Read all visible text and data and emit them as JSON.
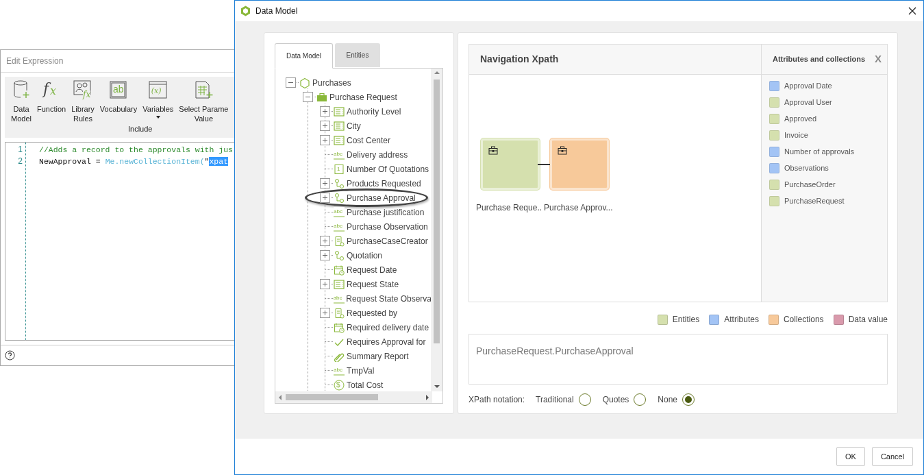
{
  "edit_window": {
    "title": "Edit Expression",
    "toolbar": [
      {
        "kind": "datamodel",
        "lines": [
          "Data",
          "Model"
        ],
        "dropdown": false
      },
      {
        "kind": "function",
        "glyphs": [
          "f",
          "x"
        ],
        "lines": [
          "Function"
        ],
        "dropdown": false
      },
      {
        "kind": "library",
        "glyphs": [
          "fx"
        ],
        "lines": [
          "Library",
          "Rules"
        ],
        "dropdown": false
      },
      {
        "kind": "vocabulary",
        "glyphs": [
          "ab"
        ],
        "lines": [
          "Vocabulary"
        ],
        "dropdown": false
      },
      {
        "kind": "variables",
        "glyphs": [
          "(x)"
        ],
        "lines": [
          "Variables"
        ],
        "dropdown": true
      },
      {
        "kind": "parameter",
        "lines": [
          "Select Parame",
          "Value"
        ],
        "dropdown": false
      }
    ],
    "group_label": "Include",
    "code_lines": [
      {
        "number": "1",
        "tokens": [
          {
            "kind": "comment",
            "text": "//Adds a record to the approvals with jus"
          }
        ]
      },
      {
        "number": "2",
        "tokens": [
          {
            "kind": "plain",
            "text": "NewApproval = "
          },
          {
            "kind": "member",
            "text": "Me.newCollectionItem("
          },
          {
            "kind": "plain",
            "text": "\""
          },
          {
            "kind": "selected",
            "text": "xpat"
          }
        ]
      }
    ]
  },
  "dialog": {
    "title": "Data Model",
    "tabs": [
      {
        "label": "Data Model",
        "selected": true
      },
      {
        "label": "Entities",
        "selected": false
      }
    ],
    "tree": [
      {
        "label": "Purchases",
        "kind": "hexagon",
        "expanded": true,
        "circled": false,
        "children": [
          {
            "label": "Purchase Request",
            "kind": "briefcase",
            "expanded": true,
            "circled": false,
            "children": [
              {
                "label": "Authority Level",
                "kind": "list",
                "expanded": false,
                "circled": false
              },
              {
                "label": "City",
                "kind": "list",
                "expanded": false,
                "circled": false
              },
              {
                "label": "Cost Center",
                "kind": "list",
                "expanded": false,
                "circled": false
              },
              {
                "label": "Delivery address",
                "kind": "text",
                "glyph": "abc",
                "circled": false
              },
              {
                "label": "Number Of Quotations",
                "kind": "number",
                "glyph": "1",
                "circled": false
              },
              {
                "label": "Products Requested",
                "kind": "relation",
                "expanded": false,
                "circled": false
              },
              {
                "label": "Purchase Approval",
                "kind": "relation",
                "expanded": false,
                "circled": true
              },
              {
                "label": "Purchase justification",
                "kind": "text",
                "glyph": "abc",
                "circled": false
              },
              {
                "label": "Purchase Observation",
                "kind": "text",
                "glyph": "abc",
                "circled": false
              },
              {
                "label": "PurchaseCaseCreator",
                "kind": "user",
                "expanded": false,
                "circled": false
              },
              {
                "label": "Quotation",
                "kind": "relation",
                "expanded": false,
                "circled": false
              },
              {
                "label": "Request Date",
                "kind": "date",
                "circled": false
              },
              {
                "label": "Request State",
                "kind": "list",
                "expanded": false,
                "circled": false
              },
              {
                "label": "Request State Observa",
                "kind": "text",
                "glyph": "abc",
                "circled": false
              },
              {
                "label": "Requested by",
                "kind": "user",
                "expanded": false,
                "circled": false
              },
              {
                "label": "Required delivery date",
                "kind": "date",
                "circled": false
              },
              {
                "label": "Requires Approval for",
                "kind": "check",
                "circled": false
              },
              {
                "label": "Summary Report",
                "kind": "clip",
                "circled": false
              },
              {
                "label": "TmpVal",
                "kind": "text",
                "glyph": "abc",
                "circled": false
              },
              {
                "label": "Total Cost",
                "kind": "money",
                "glyph": "$",
                "circled": false
              }
            ]
          }
        ]
      }
    ],
    "navigation": {
      "title": "Navigation Xpath",
      "nodes": [
        {
          "label": "Purchase Reque..",
          "color": "#d5e0ae"
        },
        {
          "label": "Purchase Approv...",
          "color": "#f7c99a"
        }
      ],
      "side_title": "Attributes and collections",
      "side_close": "X",
      "attributes": [
        {
          "label": "Approval Date",
          "color": "#a3c4f5"
        },
        {
          "label": "Approval User",
          "color": "#d5e0ae"
        },
        {
          "label": "Approved",
          "color": "#d5e0ae"
        },
        {
          "label": "Invoice",
          "color": "#d5e0ae"
        },
        {
          "label": "Number of approvals",
          "color": "#a3c4f5"
        },
        {
          "label": "Observations",
          "color": "#a3c4f5"
        },
        {
          "label": "PurchaseOrder",
          "color": "#d5e0ae"
        },
        {
          "label": "PurchaseRequest",
          "color": "#d5e0ae"
        }
      ]
    },
    "legend": [
      {
        "label": "Entities",
        "color": "#d5e0ae"
      },
      {
        "label": "Attributes",
        "color": "#a3c4f5"
      },
      {
        "label": "Collections",
        "color": "#f7c99a"
      },
      {
        "label": "Data value",
        "color": "#d99aac"
      }
    ],
    "xpath": "PurchaseRequest.PurchaseApproval",
    "notation_label": "XPath notation:",
    "notation_options": [
      {
        "label": "Traditional",
        "selected": false
      },
      {
        "label": "Quotes",
        "selected": false
      },
      {
        "label": "None",
        "selected": true
      }
    ],
    "buttons": [
      "OK",
      "Cancel"
    ]
  }
}
